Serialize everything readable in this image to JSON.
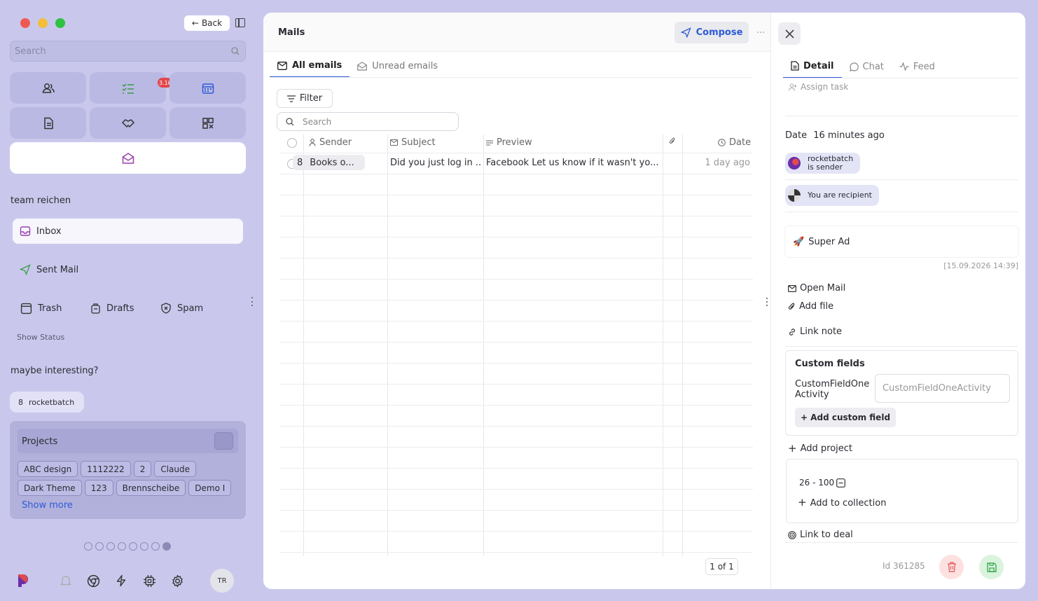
{
  "sidebar": {
    "back_label": "Back",
    "search_placeholder": "Search",
    "tasks_badge": "3.1k",
    "group1_title": "team reichen",
    "nav": {
      "inbox": "Inbox",
      "sent": "Sent Mail",
      "trash": "Trash",
      "drafts": "Drafts",
      "spam": "Spam"
    },
    "show_status": "Show Status",
    "group2_title": "maybe interesting?",
    "user_chip": {
      "avatar_char": "8",
      "name": "rocketbatch"
    },
    "projects": {
      "title": "Projects",
      "tags": [
        "ABC design",
        "1112222",
        "2",
        "Claude",
        "Dark Theme",
        "123",
        "Brennscheibe",
        "Demo I"
      ],
      "show_more": "Show more"
    },
    "avatar_initials": "TR"
  },
  "list": {
    "title": "Mails",
    "compose_label": "Compose",
    "more": "···",
    "tabs": [
      {
        "label": "All emails",
        "active": true
      },
      {
        "label": "Unread emails",
        "active": false
      }
    ],
    "filter_label": "Filter",
    "search_placeholder": "Search",
    "columns": {
      "sender": "Sender",
      "subject": "Subject",
      "preview": "Preview",
      "date": "Date"
    },
    "rows": [
      {
        "avatar_char": "8",
        "sender": "Books o...",
        "subject": "Did you just log in ...",
        "preview": "Facebook Let us know if it wasn't yo...",
        "date": "1 day ago"
      }
    ],
    "pager": "1 of 1"
  },
  "detail": {
    "tabs": [
      {
        "label": "Detail",
        "active": true
      },
      {
        "label": "Chat",
        "active": false
      },
      {
        "label": "Feed",
        "active": false
      }
    ],
    "assign_task": "Assign task",
    "date_label": "Date",
    "date_value": "16 minutes ago",
    "sender_pill": {
      "line1": "rocketbatch",
      "line2": "is sender"
    },
    "recipient_pill": "You are recipient",
    "note": {
      "emoji": "🚀",
      "text": "Super Ad",
      "timestamp": "[15.09.2026 14:39]"
    },
    "actions": {
      "open_mail": "Open Mail",
      "add_file": "Add file",
      "link_note": "Link note"
    },
    "custom_fields": {
      "title": "Custom fields",
      "field_label": "CustomFieldOne Activity",
      "field_placeholder": "CustomFieldOneActivity",
      "add_label": "+ Add custom field"
    },
    "add_project": "Add project",
    "collection": {
      "range": "26 - 100",
      "add_label": "Add to collection"
    },
    "link_deal": "Link to deal",
    "id_label": "Id 361285"
  },
  "colors": {
    "accent": "#2d5bd6",
    "sidebar_bg": "#c9c8ec",
    "badge": "#e2474c",
    "delete_bg": "#fde1e1",
    "save_bg": "#daf3dd"
  }
}
